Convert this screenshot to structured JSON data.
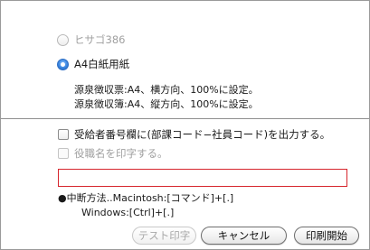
{
  "paper_options": [
    {
      "label": "ヒサゴ386",
      "selected": false,
      "enabled": false
    },
    {
      "label": "A4白紙用紙",
      "selected": true,
      "enabled": true
    }
  ],
  "paper_info": [
    "源泉徴収票:A4、横方向、100%に設定。",
    "源泉徴収簿:A4、縦方向、100%に設定。"
  ],
  "checkboxes": [
    {
      "label": "受給者番号欄に(部課コード−社員コード)を出力する。",
      "checked": false,
      "enabled": true
    },
    {
      "label": "役職名を印字する。",
      "checked": false,
      "enabled": false
    }
  ],
  "text_field": {
    "value": ""
  },
  "abort_info": {
    "line1": "●中断方法..Macintosh:[コマンド]+[.]",
    "line2": "Windows:[Ctrl]+[.]"
  },
  "buttons": {
    "test_print": "テスト印字",
    "cancel": "キャンセル",
    "start_print": "印刷開始"
  },
  "colors": {
    "accent": "#3b86e0",
    "field_border": "#d6262d",
    "disabled_text": "#a0a0a0"
  }
}
